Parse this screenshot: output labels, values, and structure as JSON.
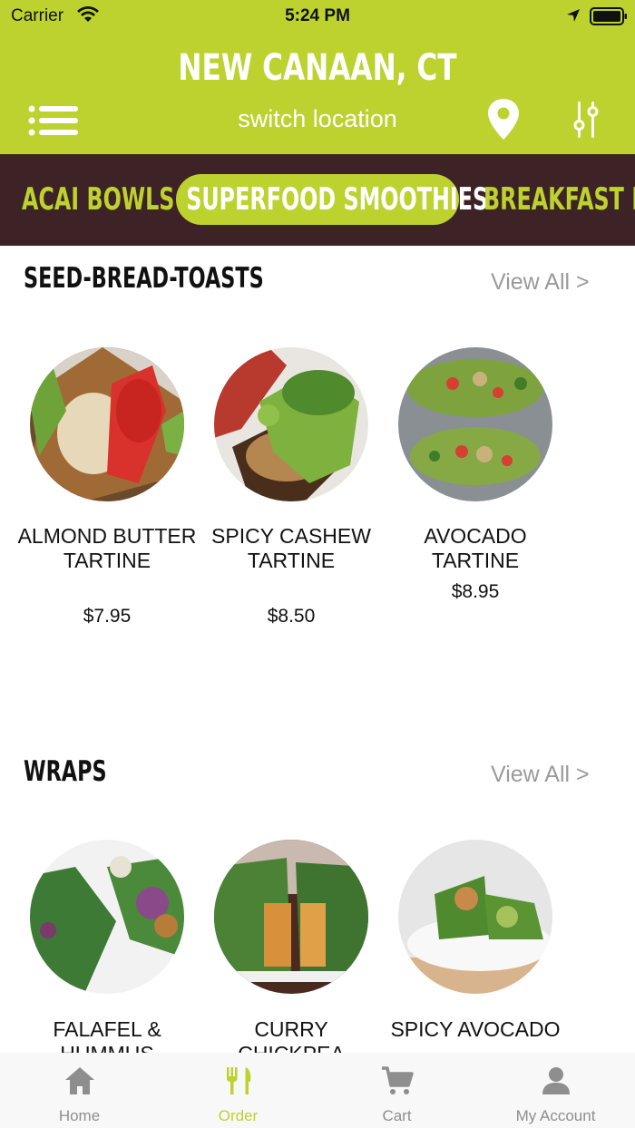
{
  "status_bar": {
    "carrier": "Carrier",
    "time": "5:24 PM"
  },
  "header": {
    "location": "NEW CANAAN, CT",
    "switch_label": "switch location"
  },
  "categories": [
    {
      "label": "ACAI BOWLS",
      "active": false
    },
    {
      "label": "SUPERFOOD SMOOTHIES",
      "active": true
    },
    {
      "label": "BREAKFAST BO",
      "active": false
    }
  ],
  "sections": [
    {
      "title": "SEED-BREAD-TOASTS",
      "view_all": "View All >",
      "items": [
        {
          "name": "ALMOND BUTTER TARTINE",
          "price": "$7.95"
        },
        {
          "name": "SPICY CASHEW TARTINE",
          "price": "$8.50"
        },
        {
          "name": "AVOCADO TARTINE",
          "price": "$8.95"
        }
      ]
    },
    {
      "title": "WRAPS",
      "view_all": "View All >",
      "items": [
        {
          "name": "FALAFEL & HUMMUS",
          "price": ""
        },
        {
          "name": "CURRY CHICKPEA",
          "price": ""
        },
        {
          "name": "SPICY AVOCADO",
          "price": ""
        }
      ]
    }
  ],
  "tabs": [
    {
      "label": "Home",
      "icon": "home-icon",
      "active": false
    },
    {
      "label": "Order",
      "icon": "fork-knife-icon",
      "active": true
    },
    {
      "label": "Cart",
      "icon": "cart-icon",
      "active": false
    },
    {
      "label": "My Account",
      "icon": "user-icon",
      "active": false
    }
  ],
  "colors": {
    "brand_green": "#bdd22e",
    "category_bg": "#3d2325",
    "muted_text": "#9a9a9a"
  }
}
